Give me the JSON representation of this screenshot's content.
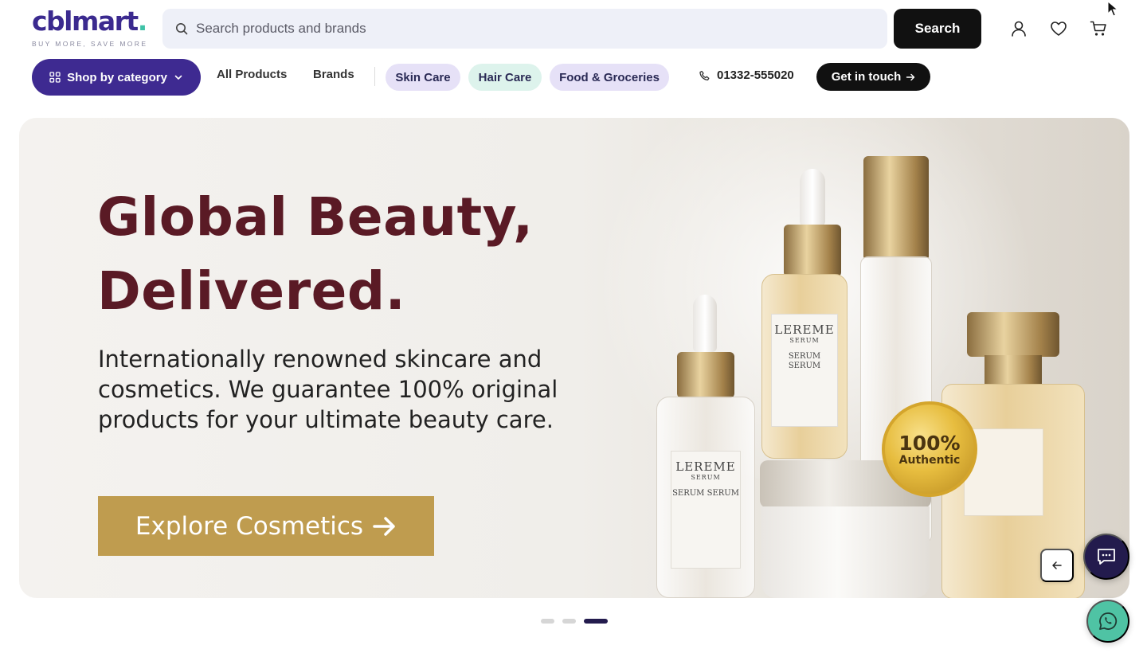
{
  "brand": {
    "logo_text": "cblmart",
    "logo_dot": ".",
    "tagline": "BUY MORE, SAVE MORE",
    "primary_color": "#3e2a91",
    "accent_color": "#3fc2a7"
  },
  "search": {
    "placeholder": "Search products and brands",
    "value": "",
    "button_label": "Search"
  },
  "header_icons": [
    "user-icon",
    "heart-icon",
    "cart-icon"
  ],
  "nav": {
    "category_button": "Shop by category",
    "links": [
      "All Products",
      "Brands"
    ],
    "pills": [
      {
        "label": "Skin Care",
        "color": "#e6e1f7"
      },
      {
        "label": "Hair Care",
        "color": "#ddf3ec"
      },
      {
        "label": "Food & Groceries",
        "color": "#e6e1f7"
      }
    ],
    "phone": "01332-555020",
    "contact_button": "Get in touch"
  },
  "hero": {
    "title_line1": "Global Beauty,",
    "title_line2": "Delivered.",
    "subtitle": "Internationally renowned skincare and cosmetics. We guarantee 100% original products for your ultimate beauty care.",
    "cta_label": "Explore Cosmetics",
    "product_label_brand": "LEREME",
    "product_label_type": "SERUM",
    "product_label_name": "SERUM SERUM",
    "seal_big": "100%",
    "seal_small": "Authentic",
    "title_color": "#5a1a25",
    "cta_color": "#bf9c4f"
  },
  "carousel": {
    "slide_count": 3,
    "active_index": 2
  }
}
